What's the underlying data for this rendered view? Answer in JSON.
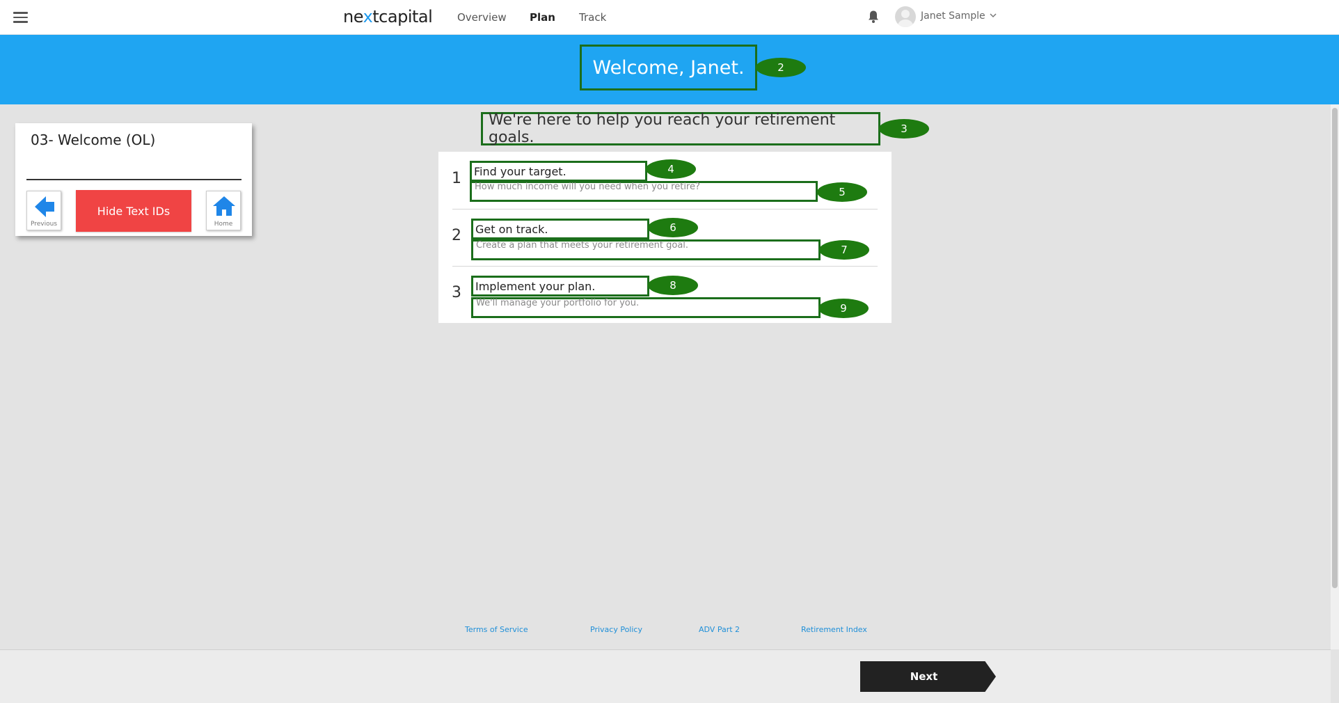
{
  "nav": {
    "logo_pre": "ne",
    "logo_x": "x",
    "logo_post": "tcapital",
    "links": [
      "Overview",
      "Plan",
      "Track"
    ],
    "active": "Plan",
    "user_name": "Janet Sample",
    "icons": {
      "menu": "hamburger-icon",
      "bell": "bell-icon",
      "avatar": "avatar",
      "dropdown": "chevron-down-icon"
    }
  },
  "banner": {
    "welcome": "Welcome, Janet.",
    "id": "2"
  },
  "subtitle": {
    "text": "We're here to help you reach your retirement goals.",
    "id": "3"
  },
  "steps": [
    {
      "number": "1",
      "title": "Find your target.",
      "title_id": "4",
      "description": "How much income will you need when you retire?",
      "description_id": "5"
    },
    {
      "number": "2",
      "title": "Get on track.",
      "title_id": "6",
      "description": "Create a plan that meets your retirement goal.",
      "description_id": "7"
    },
    {
      "number": "3",
      "title": "Implement your plan.",
      "title_id": "8",
      "description": "We'll manage your portfolio for you.",
      "description_id": "9"
    }
  ],
  "panel": {
    "title": "03- Welcome (OL)",
    "previous_label": "Previous",
    "hide_label": "Hide Text IDs",
    "home_label": "Home"
  },
  "footer": {
    "links": [
      "Terms of Service",
      "Privacy Policy",
      "ADV Part 2",
      "Retirement Index"
    ],
    "next_label": "Next"
  },
  "colors": {
    "banner": "#1fa5f2",
    "id_bubble": "#1e7b10",
    "id_outline": "#1b6e1b",
    "hide_button": "#f04444",
    "next_button": "#222222",
    "link": "#1f8fd8"
  }
}
